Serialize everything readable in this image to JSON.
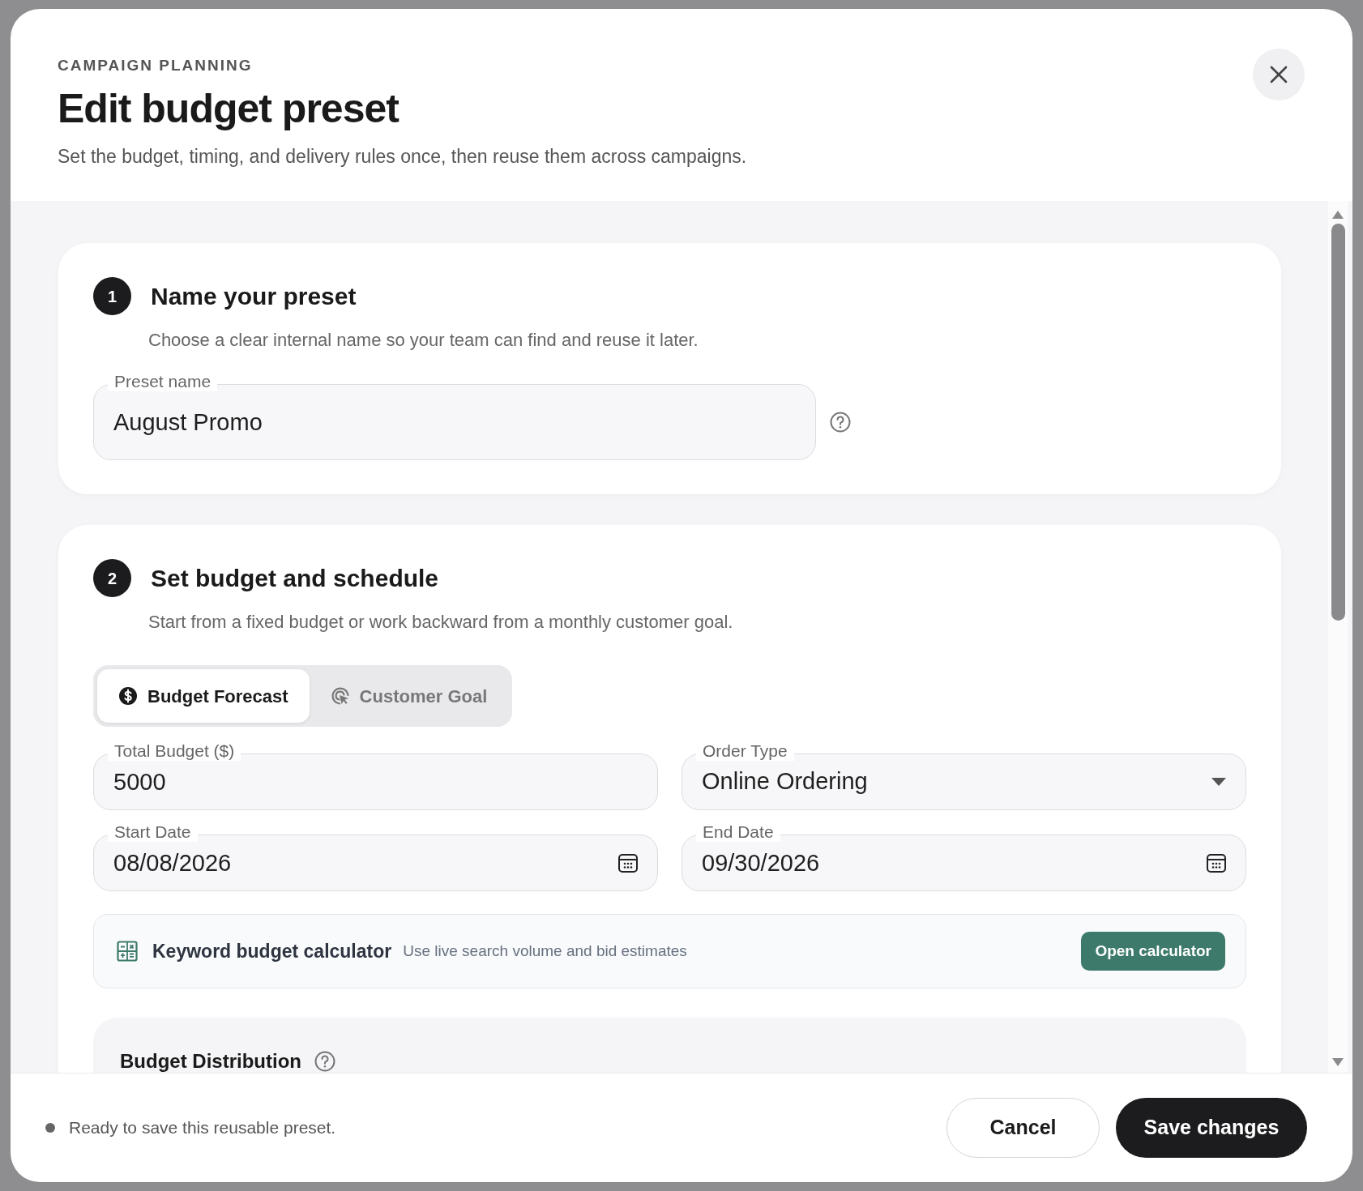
{
  "dialog": {
    "eyebrow": "CAMPAIGN PLANNING",
    "title": "Edit budget preset",
    "subtitle": "Set the budget, timing, and delivery rules once, then reuse them across campaigns."
  },
  "sections": [
    {
      "number": "1",
      "title": "Name your preset",
      "description": "Choose a clear internal name so your team can find and reuse it later.",
      "field": {
        "label": "Preset name",
        "value": "August Promo"
      }
    },
    {
      "number": "2",
      "title": "Set budget and schedule",
      "description": "Start from a fixed budget or work backward from a monthly customer goal.",
      "modes": [
        {
          "label": "Budget Forecast",
          "selected": true
        },
        {
          "label": "Customer Goal",
          "selected": false
        }
      ],
      "fields": [
        {
          "kind": "text",
          "label": "Total Budget ($)",
          "value": "5000"
        },
        {
          "kind": "select",
          "label": "Order Type",
          "value": "Online Ordering"
        },
        {
          "kind": "date",
          "label": "Start Date",
          "value": "08/08/2026"
        },
        {
          "kind": "date",
          "label": "End Date",
          "value": "09/30/2026"
        }
      ],
      "calculator": {
        "title": "Keyword budget calculator",
        "description": "Use live search volume and bid estimates",
        "button": "Open calculator"
      },
      "distribution": {
        "title": "Budget Distribution"
      }
    }
  ],
  "footer": {
    "status": "Ready to save this reusable preset.",
    "buttons": [
      {
        "label": "Cancel",
        "kind": "secondary"
      },
      {
        "label": "Save changes",
        "kind": "primary"
      }
    ]
  }
}
